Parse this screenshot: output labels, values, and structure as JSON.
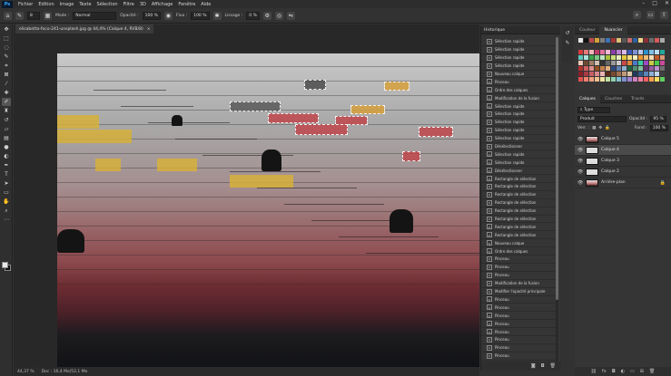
{
  "menu": {
    "logo": "Ps",
    "items": [
      "Fichier",
      "Edition",
      "Image",
      "Texte",
      "Sélection",
      "Filtre",
      "3D",
      "Affichage",
      "Fenêtre",
      "Aide"
    ],
    "window_controls": [
      "–",
      "□",
      "✕"
    ]
  },
  "options": {
    "brush_size": "8",
    "mode_label": "Mode :",
    "mode_value": "Normal",
    "opacity_label": "Opacité :",
    "opacity_value": "100 %",
    "flow_label": "Flux :",
    "flow_value": "100 %",
    "smoothing_label": "Lissage :",
    "smoothing_value": "0 %"
  },
  "document": {
    "tab_title": "elisabetta-foco-241-unsplash.jpg @ 44,4% (Calque 4, RVB/8)",
    "tab_close": "×"
  },
  "status": {
    "zoom": "44,37 %",
    "doc_info": "Doc : 16,4 Mo/52,1 Mo"
  },
  "history": {
    "title": "Historique",
    "items": [
      "Sélection rapide",
      "Sélection rapide",
      "Sélection rapide",
      "Sélection rapide",
      "Nouveau calque",
      "Pinceau",
      "Ordre des calques",
      "Modification de la fusion",
      "Sélection rapide",
      "Sélection rapide",
      "Sélection rapide",
      "Sélection rapide",
      "Sélection rapide",
      "Désélectionner",
      "Sélection rapide",
      "Sélection rapide",
      "Désélectionner",
      "Rectangle de sélection",
      "Rectangle de sélection",
      "Rectangle de sélection",
      "Rectangle de sélection",
      "Rectangle de sélection",
      "Rectangle de sélection",
      "Rectangle de sélection",
      "Rectangle de sélection",
      "Nouveau calque",
      "Ordre des calques",
      "Pinceau",
      "Pinceau",
      "Pinceau",
      "Modification de la fusion",
      "Modifier l'opacité principale",
      "Pinceau",
      "Pinceau",
      "Pinceau",
      "Pinceau",
      "Pinceau",
      "Pinceau",
      "Pinceau",
      "Pinceau"
    ]
  },
  "swatches": {
    "tab_color": "Couleur",
    "tab_swatches": "Nuancier",
    "recent": [
      "#e8e8e8",
      "#111111",
      "#b84a4e",
      "#d4a23a",
      "#7e7e7e",
      "#3e72b5",
      "#a33636",
      "#e0c07e",
      "#555555",
      "#c96b6b",
      "#2d5fa0",
      "#f0d48a",
      "#8a2f35",
      "#6c6c6c",
      "#d85a5a",
      "#aaaaaa"
    ],
    "grid": [
      "#d93b3b",
      "#e87a7a",
      "#f2b8b8",
      "#c23c6a",
      "#e0709e",
      "#f3b9d2",
      "#8a3fa8",
      "#b97fd1",
      "#d8b8e8",
      "#3c58b8",
      "#7d93d8",
      "#bcc8ee",
      "#2e8fc8",
      "#7ec0e6",
      "#b9dcf2",
      "#22a89a",
      "#5fc6bb",
      "#a8e2dc",
      "#3aa64a",
      "#7ccb84",
      "#bde4c1",
      "#a7c23a",
      "#cbdd7c",
      "#e4eebd",
      "#e8c93a",
      "#f1dc80",
      "#f8edbf",
      "#e8962e",
      "#f2bb78",
      "#f8dcb9",
      "#c2572a",
      "#dd9575",
      "#efcab8",
      "#6e4a33",
      "#a07f66",
      "#d0bfb2",
      "#333333",
      "#666666",
      "#999999",
      "#cccccc",
      "#c94a4a",
      "#d88a3a",
      "#4a7ac9",
      "#3ac9a0",
      "#9a4ac9",
      "#c9c94a",
      "#4ac94a",
      "#c94a9a",
      "#b03030",
      "#d06060",
      "#e09090",
      "#905020",
      "#c08050",
      "#e0b080",
      "#304880",
      "#6080b0",
      "#90b0d0",
      "#206040",
      "#509070",
      "#80c0a0",
      "#603070",
      "#9060a0",
      "#c090d0",
      "#707070",
      "#8a1f28",
      "#a83a44",
      "#c45e66",
      "#d8888e",
      "#e9b3b6",
      "#5a2a1a",
      "#7a4a30",
      "#a07050",
      "#c09a78",
      "#dcc4a8",
      "#1f3a5a",
      "#2f5a8a",
      "#5a86b8",
      "#8eb0d8",
      "#c0d4ec",
      "#404040",
      "#e05050",
      "#f08070",
      "#f0a080",
      "#f0c090",
      "#f0e0a0",
      "#c0e0a0",
      "#90d0b0",
      "#80c0d0",
      "#8090d0",
      "#a080d0",
      "#d080c0",
      "#f080a0",
      "#ff6060",
      "#ffa050",
      "#ffe060",
      "#60d060"
    ]
  },
  "layers": {
    "tabs": [
      "Calques",
      "Couches",
      "Tracés"
    ],
    "filter_value": "Type",
    "blend_value": "Produit",
    "opacity_label": "Opacité :",
    "opacity_value": "95 %",
    "lock_label": "Verr. :",
    "fill_label": "Fond :",
    "fill_value": "100 %",
    "items": [
      {
        "name": "Calque 5",
        "thumb": "red",
        "selected": false
      },
      {
        "name": "Calque 4",
        "thumb": "white",
        "selected": true
      },
      {
        "name": "Calque 3",
        "thumb": "white",
        "selected": false
      },
      {
        "name": "Calque 2",
        "thumb": "white",
        "selected": false
      },
      {
        "name": "Arrière-plan",
        "thumb": "photo",
        "selected": false
      }
    ]
  }
}
